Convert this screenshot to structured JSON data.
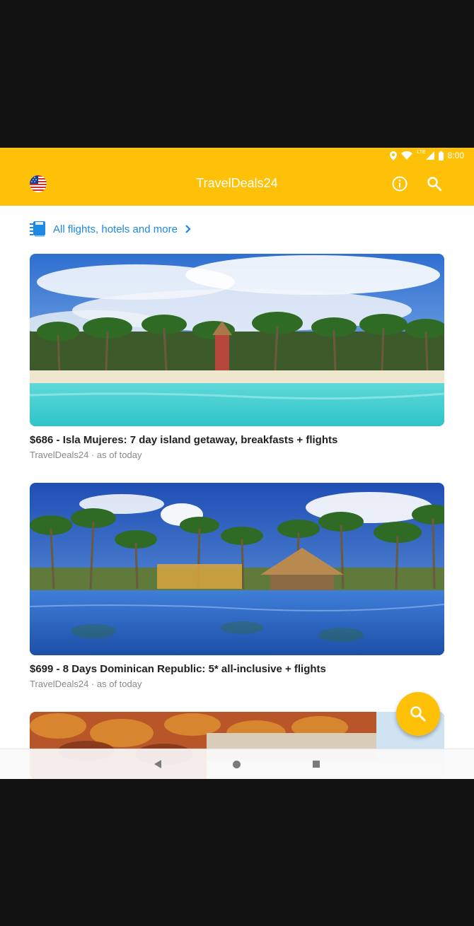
{
  "status_bar": {
    "time": "8:00",
    "network": "LTE"
  },
  "app_bar": {
    "title": "TravelDeals24"
  },
  "all_link": {
    "label": "All flights, hotels and more"
  },
  "deals": [
    {
      "title": "$686 - Isla Mujeres: 7 day island getaway, breakfasts + flights",
      "source": "TravelDeals24 · as of today"
    },
    {
      "title": "$699 - 8 Days Dominican Republic: 5* all-inclusive + flights",
      "source": "TravelDeals24 · as of today"
    }
  ],
  "colors": {
    "primary": "#FFC107",
    "link": "#1E88E5"
  },
  "icons": {
    "country": "us-flag-icon",
    "info": "info-icon",
    "search": "search-icon",
    "fab": "search-icon"
  }
}
